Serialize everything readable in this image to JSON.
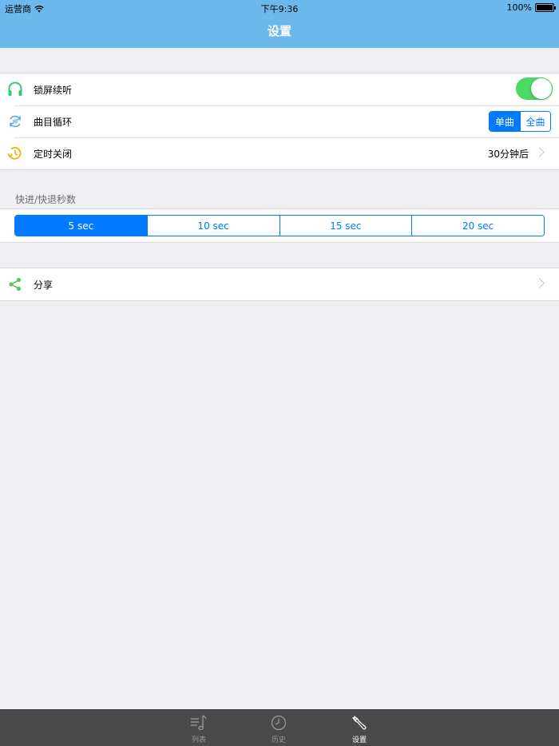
{
  "status_bar": {
    "carrier": "运营商",
    "time": "下午9:36",
    "battery": "100%"
  },
  "nav": {
    "title": "设置"
  },
  "settings": {
    "lock_screen_label": "锁屏续听",
    "lock_screen_on": true,
    "loop_label": "曲目循环",
    "loop_options": [
      "单曲",
      "全曲"
    ],
    "loop_selected": "单曲",
    "timer_label": "定时关闭",
    "timer_value": "30分钟后"
  },
  "seek": {
    "header": "快进/快退秒数",
    "options": [
      "5 sec",
      "10 sec",
      "15 sec",
      "20 sec"
    ],
    "selected": "5 sec"
  },
  "share": {
    "label": "分享"
  },
  "tabbar": {
    "tabs": [
      {
        "label": "列表",
        "icon": "music-list-icon"
      },
      {
        "label": "历史",
        "icon": "clock-icon"
      },
      {
        "label": "设置",
        "icon": "wrench-icon"
      }
    ],
    "active": "设置"
  },
  "colors": {
    "nav_bar": "#6cb8ec",
    "accent": "#007aff",
    "toggle_on": "#4cd964",
    "background": "#efeff4"
  }
}
